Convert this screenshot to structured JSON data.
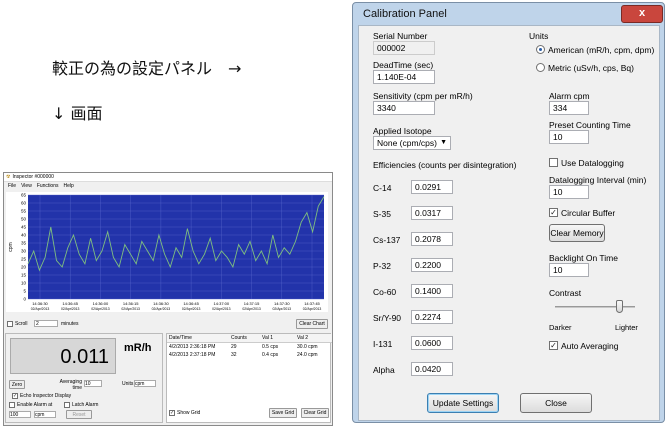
{
  "caption": {
    "line1": "較正の為の設定パネル　→",
    "line2": "↓ 画面"
  },
  "inspector": {
    "title": "Inspector #000000",
    "menu": [
      "File",
      "View",
      "Functions",
      "Help"
    ],
    "chart": {
      "ylabel": "cpm",
      "y_ticks": [
        "65",
        "60",
        "55",
        "50",
        "45",
        "40",
        "35",
        "30",
        "25",
        "20",
        "15",
        "10",
        "5",
        "0"
      ],
      "x_ticks": [
        {
          "time": "14:36:30",
          "date": "02/Apr/2013"
        },
        {
          "time": "14:36:45",
          "date": "02/Apr/2013"
        },
        {
          "time": "14:36:00",
          "date": "02/Apr/2013"
        },
        {
          "time": "14:36:15",
          "date": "02/Apr/2013"
        },
        {
          "time": "14:36:30",
          "date": "02/Apr/2013"
        },
        {
          "time": "14:36:45",
          "date": "02/Apr/2013"
        },
        {
          "time": "14:37:00",
          "date": "02/Apr/2013"
        },
        {
          "time": "14:37:15",
          "date": "02/Apr/2013"
        },
        {
          "time": "14:37:30",
          "date": "02/Apr/2013"
        },
        {
          "time": "14:37:45",
          "date": "02/Apr/2013"
        }
      ],
      "series": [
        22,
        30,
        18,
        26,
        45,
        24,
        20,
        32,
        40,
        28,
        22,
        38,
        24,
        30,
        42,
        26,
        20,
        34,
        28,
        22,
        36,
        30,
        24,
        40,
        28,
        20,
        32,
        26,
        44,
        30,
        22,
        28,
        38,
        24,
        30,
        26,
        20,
        34,
        28,
        36,
        24,
        30,
        22,
        40,
        26,
        32,
        28,
        36,
        48,
        54,
        42,
        58,
        64
      ]
    },
    "scroll_label": "Scroll",
    "scroll_value": "2",
    "scroll_unit": "minutes",
    "clear_chart": "Clear Chart",
    "reading": "0.011",
    "reading_unit": "mR/h",
    "zero_btn": "Zero",
    "averaging_label": "Averaging time",
    "averaging_value": "10",
    "units_label": "Units",
    "units_value": "cpm",
    "echo_label": "Echo Inspector Display",
    "enable_alarm": "Enable Alarm at",
    "latch_alarm": "Latch Alarm",
    "alarm_value": "100",
    "alarm_unit": "cpm",
    "reset_btn": "Reset",
    "table": {
      "headers": [
        "Date/Time",
        "Counts",
        "Val 1",
        "Val 2"
      ],
      "rows": [
        [
          "4/2/2013 2:36:18 PM",
          "29",
          "0.5 cps",
          "30.0 cpm"
        ],
        [
          "4/2/2013 2:37:18 PM",
          "32",
          "0.4 cps",
          "24.0 cpm"
        ]
      ]
    },
    "show_grid": "Show Grid",
    "save_grid": "Save Grid",
    "clear_grid": "Clear Grid"
  },
  "calibration": {
    "title": "Calibration Panel",
    "close_glyph": "x",
    "serial_label": "Serial Number",
    "serial_value": "000002",
    "deadtime_label": "DeadTime (sec)",
    "deadtime_value": "1.140E-04",
    "sensitivity_label": "Sensitivity (cpm per mR/h)",
    "sensitivity_value": "3340",
    "isotope_label": "Applied Isotope",
    "isotope_value": "None (cpm/cps)",
    "units_label": "Units",
    "unit_options": [
      {
        "label": "American (mR/h, cpm, dpm)",
        "selected": true
      },
      {
        "label": "Metric (uSv/h, cps, Bq)",
        "selected": false
      }
    ],
    "alarm_label": "Alarm cpm",
    "alarm_value": "334",
    "preset_label": "Preset Counting Time",
    "preset_value": "10",
    "efficiencies_label": "Efficiencies (counts per disintegration)",
    "efficiencies": [
      {
        "isotope": "C-14",
        "value": "0.0291"
      },
      {
        "isotope": "S-35",
        "value": "0.0317"
      },
      {
        "isotope": "Cs-137",
        "value": "0.2078"
      },
      {
        "isotope": "P-32",
        "value": "0.2200"
      },
      {
        "isotope": "Co-60",
        "value": "0.1400"
      },
      {
        "isotope": "Sr/Y-90",
        "value": "0.2274"
      },
      {
        "isotope": "I-131",
        "value": "0.0600"
      },
      {
        "isotope": "Alpha",
        "value": "0.0420"
      }
    ],
    "use_datalogging": "Use Datalogging",
    "datalog_interval_label": "Datalogging Interval (min)",
    "datalog_interval_value": "10",
    "circular_buffer": "Circular Buffer",
    "clear_memory": "Clear Memory",
    "backlight_label": "Backlight On Time",
    "backlight_value": "10",
    "contrast_label": "Contrast",
    "contrast_level": 0.8,
    "darker": "Darker",
    "lighter": "Lighter",
    "auto_averaging": "Auto Averaging",
    "update_settings": "Update Settings",
    "close_btn": "Close",
    "colors": {
      "chart_bg": "#2233aa",
      "chart_line": "#7fbf7f",
      "title_bar": "#bfd4ea",
      "close_red": "#c9463d"
    }
  }
}
